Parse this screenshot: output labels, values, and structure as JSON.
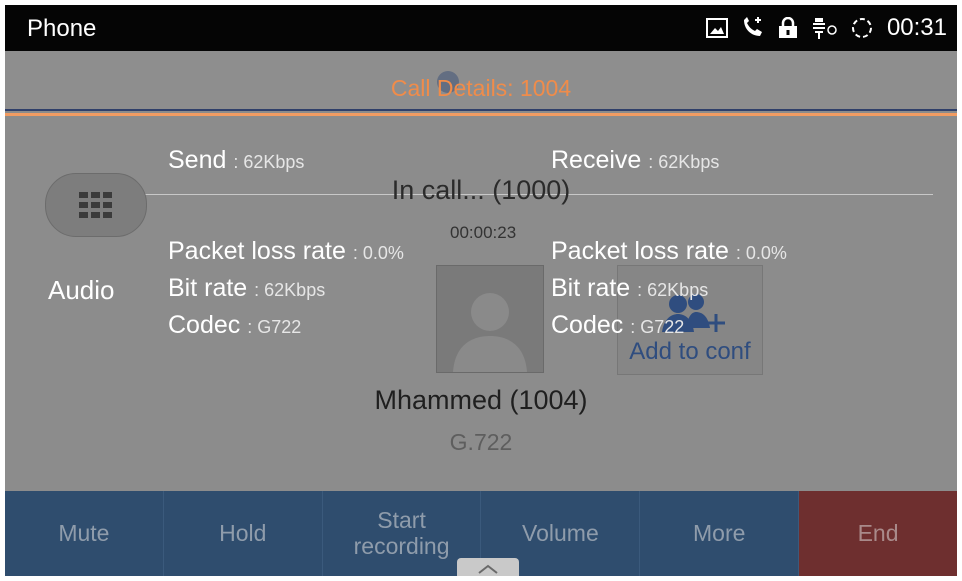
{
  "status_bar": {
    "app_title": "Phone",
    "icons": [
      "gallery-icon",
      "call-icon",
      "lock-icon",
      "usb-debug-icon",
      "sync-icon"
    ],
    "time": "00:31"
  },
  "call_screen": {
    "status": "In call... (1000)",
    "duration": "00:00:23",
    "caller_name": "Mhammed (1004)",
    "codec": "G.722",
    "add_to_conf_label": "Add to conf"
  },
  "call_details": {
    "title": "Call Details: 1004",
    "media_type": "Audio",
    "send": {
      "label": "Send",
      "value": ": 62Kbps",
      "packet_loss_label": "Packet loss rate",
      "packet_loss_value": ": 0.0%",
      "bit_rate_label": "Bit rate",
      "bit_rate_value": ": 62Kbps",
      "codec_label": "Codec",
      "codec_value": ": G722"
    },
    "receive": {
      "label": "Receive",
      "value": ": 62Kbps",
      "packet_loss_label": "Packet loss rate",
      "packet_loss_value": ": 0.0%",
      "bit_rate_label": "Bit rate",
      "bit_rate_value": ": 62Kbps",
      "codec_label": "Codec",
      "codec_value": ": G722"
    }
  },
  "action_bar": {
    "mute": "Mute",
    "hold": "Hold",
    "start_recording_line1": "Start",
    "start_recording_line2": "recording",
    "volume": "Volume",
    "more": "More",
    "end": "End"
  },
  "colors": {
    "overlay_gray": "#8c8c8c",
    "title_orange": "#f08c4a",
    "action_bar_blue": "#2f4d6e",
    "end_red": "#6e2f2f"
  }
}
